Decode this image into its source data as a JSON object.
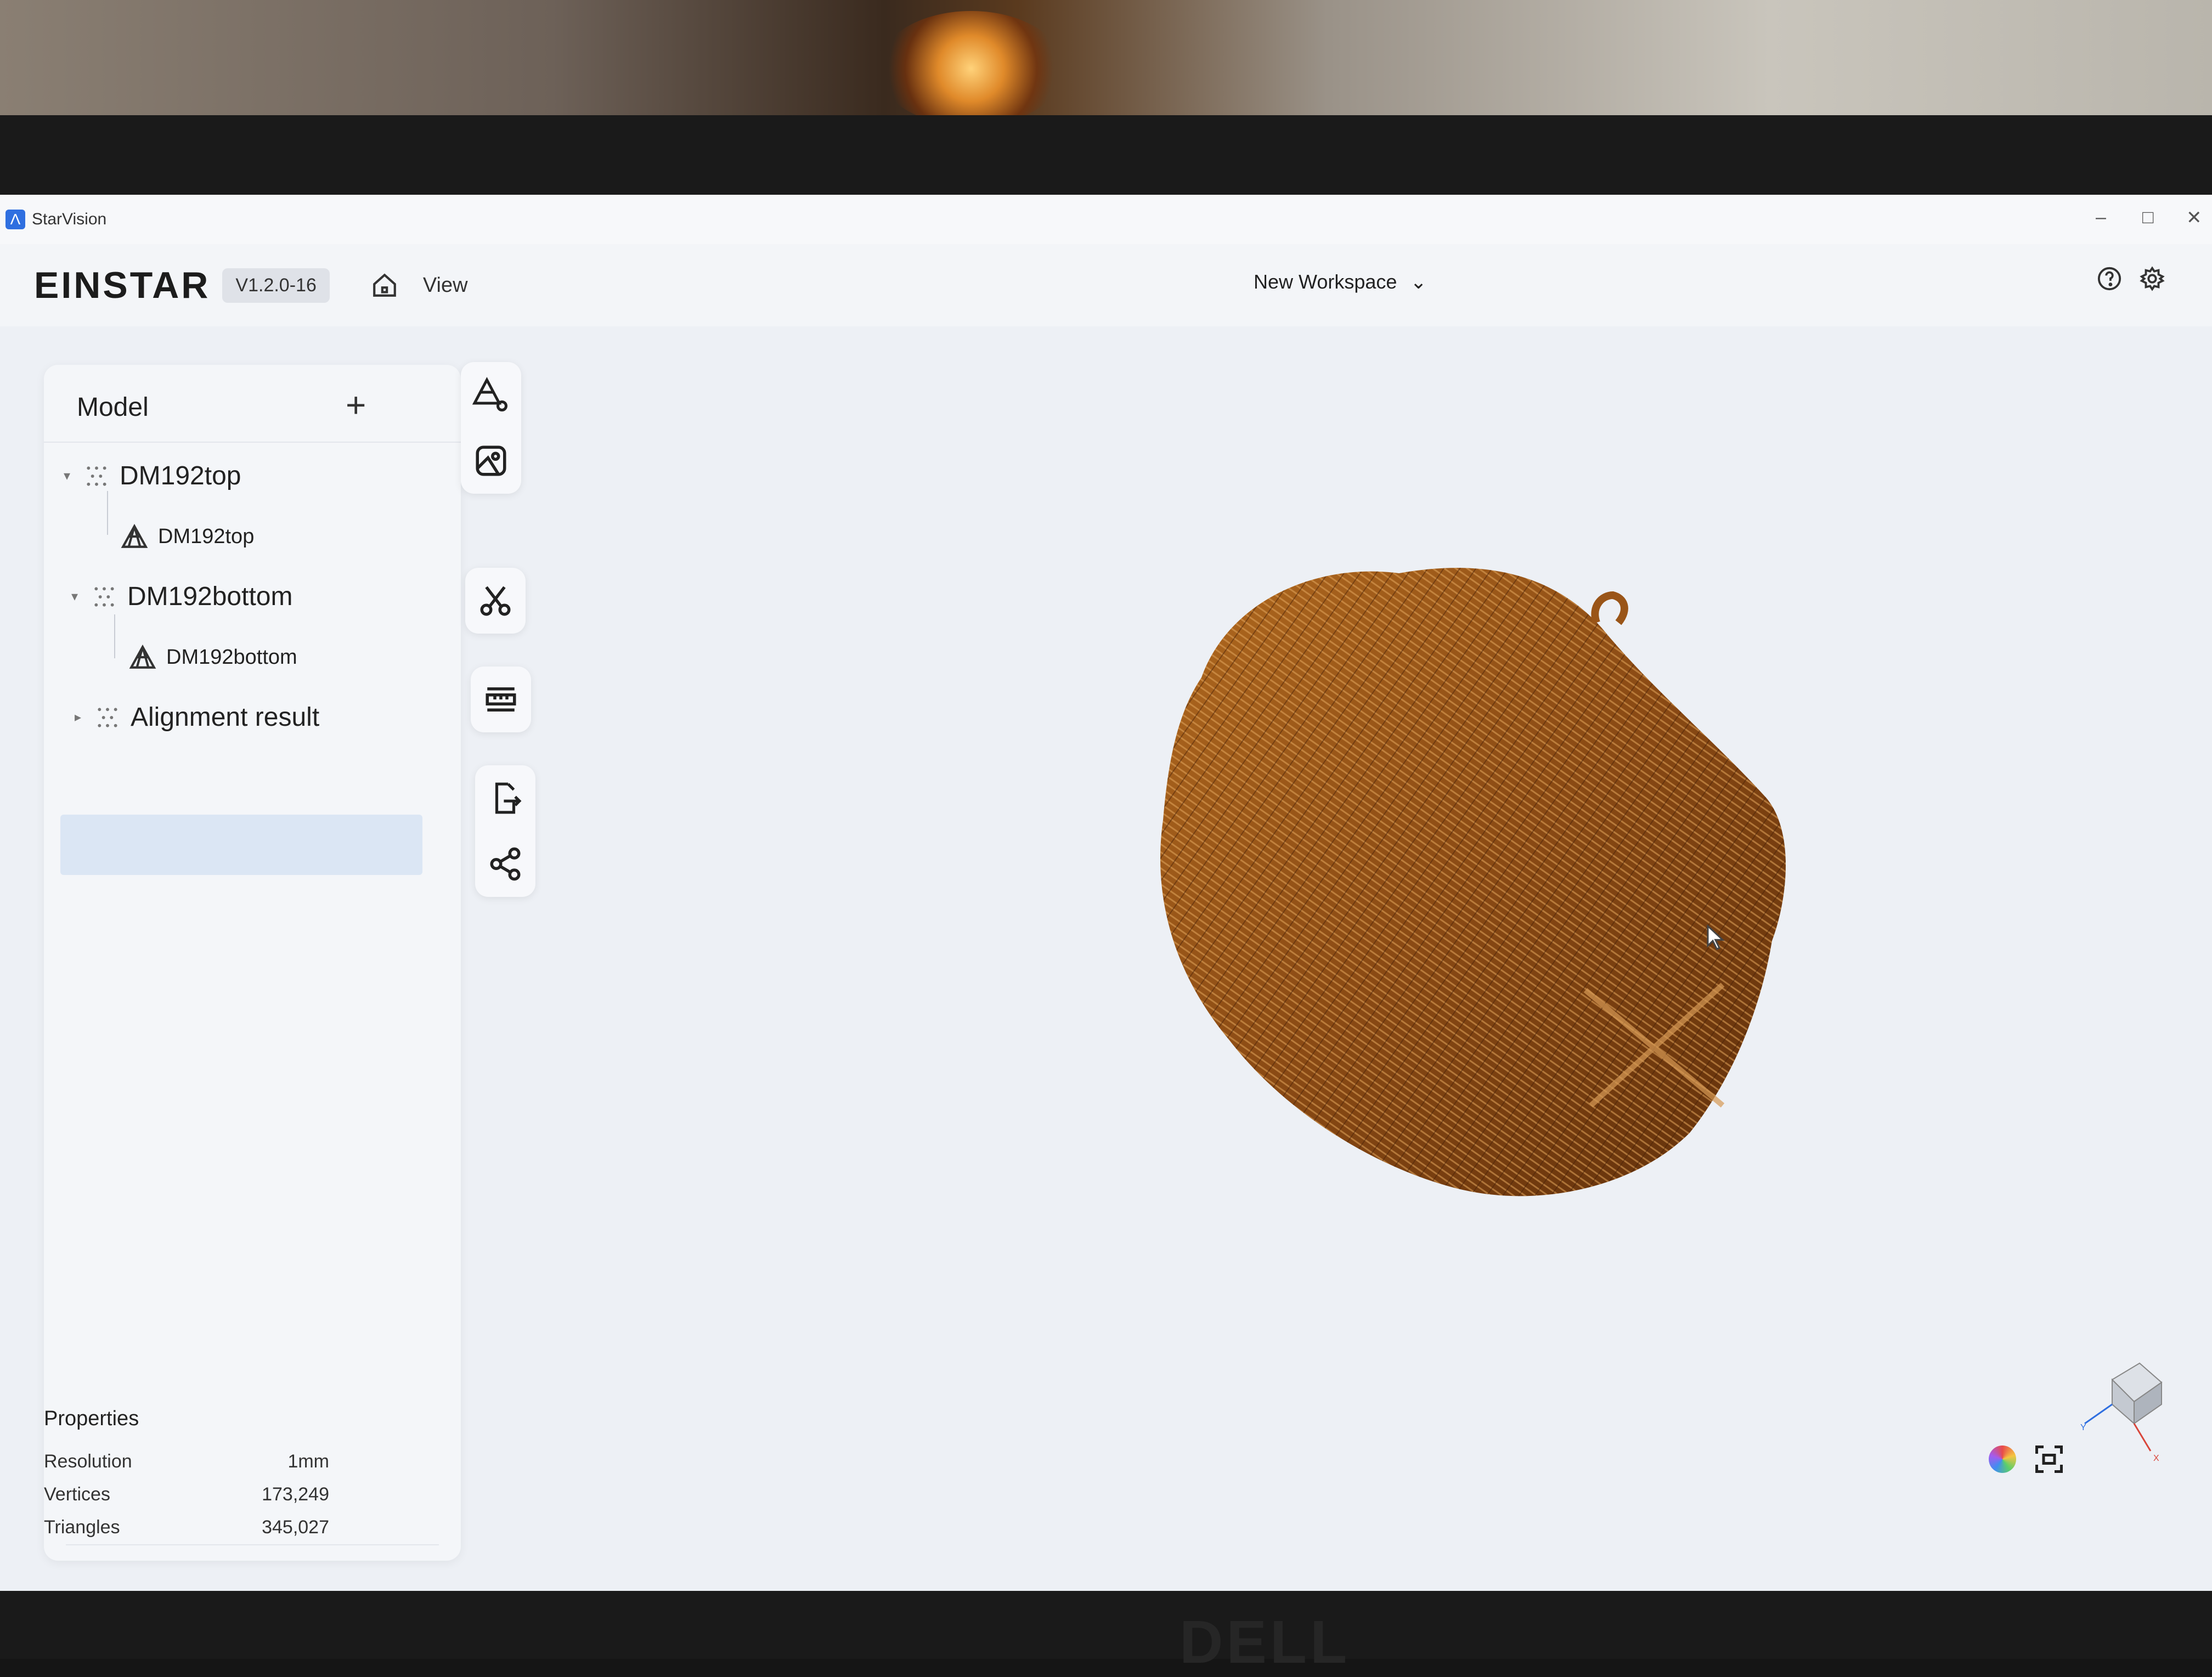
{
  "window": {
    "app_name": "StarVision",
    "controls": [
      "–",
      "□",
      "✕"
    ]
  },
  "header": {
    "logo": "EINSTAR",
    "version": "V1.2.0-16",
    "menu_view": "View",
    "workspace": "New Workspace",
    "workspace_chevron": "⌄"
  },
  "model_panel": {
    "title": "Model",
    "add_label": "+",
    "tree": [
      {
        "group": "DM192top",
        "mesh": "DM192top",
        "expanded": true
      },
      {
        "group": "DM192bottom",
        "mesh": "DM192bottom",
        "expanded": true,
        "selected_mesh": true
      },
      {
        "group": "Alignment result",
        "expanded": false
      }
    ],
    "caret_open": "▾",
    "caret_closed": "▸"
  },
  "properties": {
    "title": "Properties",
    "rows": [
      {
        "label": "Resolution",
        "value": "1mm"
      },
      {
        "label": "Vertices",
        "value": "173,249"
      },
      {
        "label": "Triangles",
        "value": "345,027"
      }
    ]
  },
  "toolbar": {
    "icons": [
      "mesh-edit-icon",
      "texture-icon",
      "scissors-icon",
      "measure-icon",
      "export-icon",
      "share-icon"
    ]
  },
  "viewport": {
    "model_color": "#8a4a14",
    "axis_labels": {
      "x": "X",
      "y": "Y"
    }
  },
  "screen_brand": "DELL"
}
